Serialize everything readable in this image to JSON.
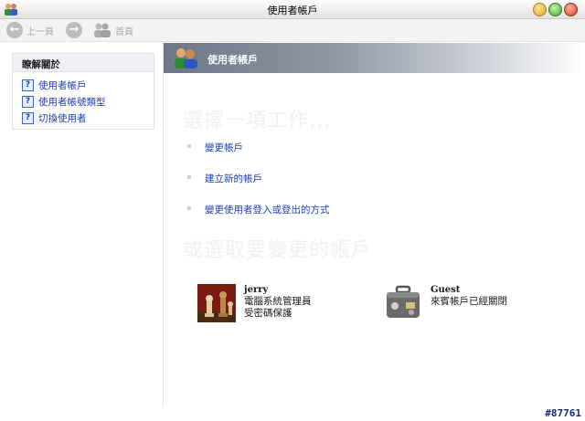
{
  "window": {
    "title": "使用者帳戶"
  },
  "toolbar": {
    "back_label": "上一頁",
    "home_label": "首頁"
  },
  "sidebar": {
    "heading": "瞭解關於",
    "items": [
      {
        "label": "使用者帳戶",
        "icon": "help-icon"
      },
      {
        "label": "使用者帳號類型",
        "icon": "help-icon"
      },
      {
        "label": "切換使用者",
        "icon": "help-icon"
      }
    ]
  },
  "header": {
    "title": "使用者帳戶",
    "icon": "users-icon"
  },
  "main": {
    "pick_task_heading": "選擇一項工作...",
    "tasks": [
      {
        "label": "變更帳戶"
      },
      {
        "label": "建立新的帳戶"
      },
      {
        "label": "變更使用者登入或登出的方式"
      }
    ],
    "pick_account_heading": "或選取要變更的帳戶",
    "accounts": [
      {
        "name": "jerry",
        "lines": [
          "電腦系統管理員",
          "受密碼保護"
        ],
        "picture": "chess-picture"
      },
      {
        "name": "Guest",
        "lines": [
          "來賓帳戶已經關閉"
        ],
        "picture": "suitcase-picture"
      }
    ]
  },
  "watermark": "#87761",
  "colors": {
    "link": "#1f3dbb",
    "header_start": "#6d7787"
  }
}
